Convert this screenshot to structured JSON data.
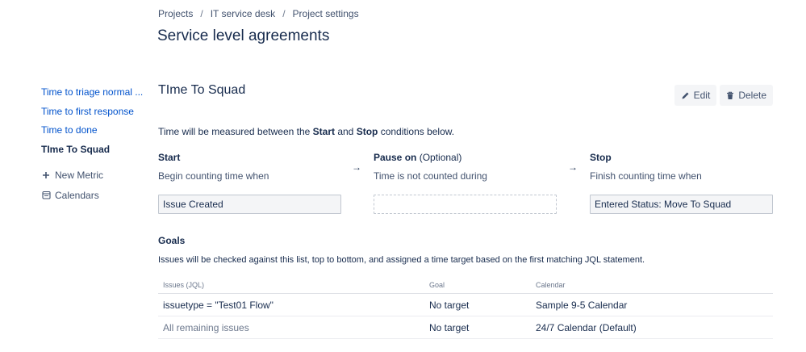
{
  "breadcrumb": [
    {
      "label": "Projects"
    },
    {
      "label": "IT service desk"
    },
    {
      "label": "Project settings"
    }
  ],
  "page_title": "Service level agreements",
  "sidebar": {
    "items": [
      {
        "label": "Time to triage normal ..."
      },
      {
        "label": "Time to first response"
      },
      {
        "label": "Time to done"
      },
      {
        "label": "TIme To Squad",
        "active": true
      }
    ],
    "new_metric_label": "New Metric",
    "calendars_label": "Calendars"
  },
  "metric": {
    "title": "TIme To Squad",
    "edit_label": "Edit",
    "delete_label": "Delete"
  },
  "measure": {
    "prefix": "Time will be measured between the ",
    "start_word": "Start",
    "and_word": " and ",
    "stop_word": "Stop",
    "suffix": " conditions below."
  },
  "conditions": {
    "start": {
      "title": "Start",
      "desc": "Begin counting time when",
      "value": "Issue Created"
    },
    "pause": {
      "title": "Pause on",
      "optional": "(Optional)",
      "desc": "Time is not counted during",
      "value": ""
    },
    "stop": {
      "title": "Stop",
      "desc": "Finish counting time when",
      "value": "Entered Status: Move To Squad"
    },
    "arrow": "→"
  },
  "goals": {
    "title": "Goals",
    "description": "Issues will be checked against this list, top to bottom, and assigned a time target based on the first matching JQL statement.",
    "columns": [
      "Issues (JQL)",
      "Goal",
      "Calendar"
    ],
    "rows": [
      {
        "jql": "issuetype = \"Test01 Flow\"",
        "goal": "No target",
        "calendar": "Sample 9-5 Calendar"
      },
      {
        "jql": "All remaining issues",
        "goal": "No target",
        "calendar": "24/7 Calendar (Default)"
      }
    ]
  },
  "colors": {
    "link": "#0052cc",
    "text": "#172b4d",
    "muted": "#6b778c",
    "button_bg": "#f4f5f7"
  }
}
